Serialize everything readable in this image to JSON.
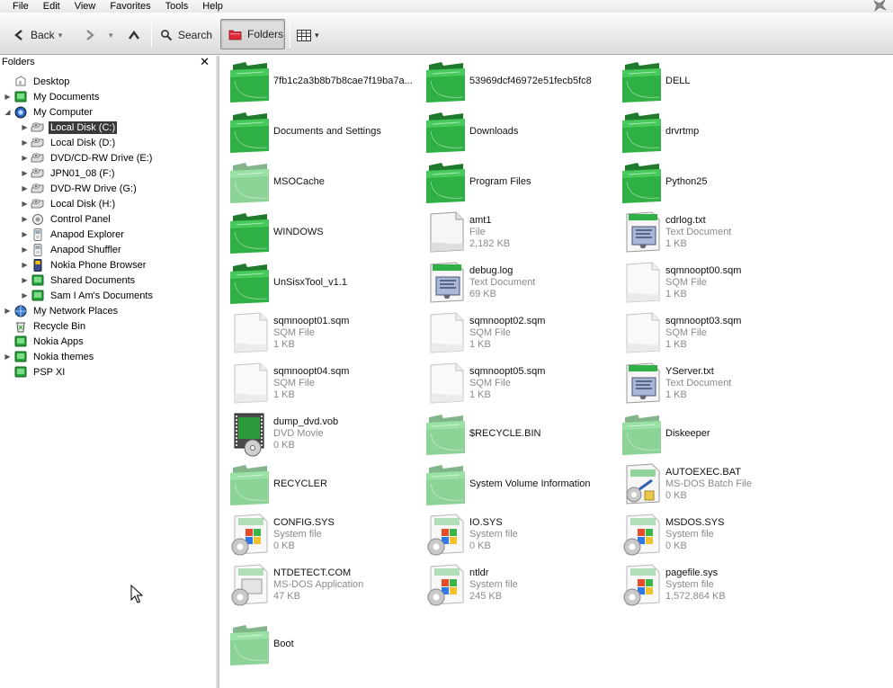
{
  "menu": [
    "File",
    "Edit",
    "View",
    "Favorites",
    "Tools",
    "Help"
  ],
  "toolbar": {
    "back_label": "Back",
    "search_label": "Search",
    "folders_label": "Folders"
  },
  "folders_pane": {
    "title": "Folders",
    "close_glyph": "✕"
  },
  "tree": [
    {
      "label": "Desktop",
      "indent": 0,
      "expander": "",
      "icon": "desktop-icon"
    },
    {
      "label": "My Documents",
      "indent": 0,
      "expander": "▶",
      "icon": "green-folder-icon"
    },
    {
      "label": "My Computer",
      "indent": 0,
      "expander": "◢",
      "icon": "computer-icon"
    },
    {
      "label": "Local Disk (C:)",
      "indent": 1,
      "expander": "▶",
      "icon": "drive-icon",
      "selected": true
    },
    {
      "label": "Local Disk (D:)",
      "indent": 1,
      "expander": "▶",
      "icon": "drive-icon"
    },
    {
      "label": "DVD/CD-RW Drive (E:)",
      "indent": 1,
      "expander": "▶",
      "icon": "drive-icon"
    },
    {
      "label": "JPN01_08 (F:)",
      "indent": 1,
      "expander": "▶",
      "icon": "drive-icon"
    },
    {
      "label": "DVD-RW Drive (G:)",
      "indent": 1,
      "expander": "▶",
      "icon": "drive-icon"
    },
    {
      "label": "Local Disk (H:)",
      "indent": 1,
      "expander": "▶",
      "icon": "drive-icon"
    },
    {
      "label": "Control Panel",
      "indent": 1,
      "expander": "▶",
      "icon": "control-panel-icon"
    },
    {
      "label": "Anapod Explorer",
      "indent": 1,
      "expander": "▶",
      "icon": "ipod-icon"
    },
    {
      "label": "Anapod Shuffler",
      "indent": 1,
      "expander": "▶",
      "icon": "ipod-icon"
    },
    {
      "label": "Nokia Phone Browser",
      "indent": 1,
      "expander": "▶",
      "icon": "phone-icon"
    },
    {
      "label": "Shared Documents",
      "indent": 1,
      "expander": "▶",
      "icon": "green-folder-icon"
    },
    {
      "label": "Sam I Am's Documents",
      "indent": 1,
      "expander": "▶",
      "icon": "green-folder-icon"
    },
    {
      "label": "My Network Places",
      "indent": 0,
      "expander": "▶",
      "icon": "network-icon"
    },
    {
      "label": "Recycle Bin",
      "indent": 0,
      "expander": "",
      "icon": "recycle-bin-icon"
    },
    {
      "label": "Nokia Apps",
      "indent": 0,
      "expander": "",
      "icon": "green-folder-icon"
    },
    {
      "label": "Nokia themes",
      "indent": 0,
      "expander": "▶",
      "icon": "green-folder-icon"
    },
    {
      "label": "PSP XI",
      "indent": 0,
      "expander": "",
      "icon": "green-folder-icon"
    }
  ],
  "files": [
    {
      "name": "7fb1c2a3b8b7b8cae7f19ba7a...",
      "type": "",
      "size": "",
      "icon": "folder"
    },
    {
      "name": "53969dcf46972e51fecb5fc8",
      "type": "",
      "size": "",
      "icon": "folder"
    },
    {
      "name": "DELL",
      "type": "",
      "size": "",
      "icon": "folder"
    },
    {
      "name": "Documents and Settings",
      "type": "",
      "size": "",
      "icon": "folder"
    },
    {
      "name": "Downloads",
      "type": "",
      "size": "",
      "icon": "folder"
    },
    {
      "name": "drvrtmp",
      "type": "",
      "size": "",
      "icon": "folder"
    },
    {
      "name": "MSOCache",
      "type": "",
      "size": "",
      "icon": "folder-hidden"
    },
    {
      "name": "Program Files",
      "type": "",
      "size": "",
      "icon": "folder"
    },
    {
      "name": "Python25",
      "type": "",
      "size": "",
      "icon": "folder"
    },
    {
      "name": "WINDOWS",
      "type": "",
      "size": "",
      "icon": "folder"
    },
    {
      "name": "amt1",
      "type": "File",
      "size": "2,182 KB",
      "icon": "file"
    },
    {
      "name": "cdrlog.txt",
      "type": "Text Document",
      "size": "1 KB",
      "icon": "text"
    },
    {
      "name": "UnSisxTool_v1.1",
      "type": "",
      "size": "",
      "icon": "folder"
    },
    {
      "name": "debug.log",
      "type": "Text Document",
      "size": "69 KB",
      "icon": "text"
    },
    {
      "name": "sqmnoopt00.sqm",
      "type": "SQM File",
      "size": "1 KB",
      "icon": "file-hidden"
    },
    {
      "name": "sqmnoopt01.sqm",
      "type": "SQM File",
      "size": "1 KB",
      "icon": "file-hidden"
    },
    {
      "name": "sqmnoopt02.sqm",
      "type": "SQM File",
      "size": "1 KB",
      "icon": "file-hidden"
    },
    {
      "name": "sqmnoopt03.sqm",
      "type": "SQM File",
      "size": "1 KB",
      "icon": "file-hidden"
    },
    {
      "name": "sqmnoopt04.sqm",
      "type": "SQM File",
      "size": "1 KB",
      "icon": "file-hidden"
    },
    {
      "name": "sqmnoopt05.sqm",
      "type": "SQM File",
      "size": "1 KB",
      "icon": "file-hidden"
    },
    {
      "name": "YServer.txt",
      "type": "Text Document",
      "size": "1 KB",
      "icon": "text"
    },
    {
      "name": "dump_dvd.vob",
      "type": "DVD Movie",
      "size": "0 KB",
      "icon": "video"
    },
    {
      "name": "$RECYCLE.BIN",
      "type": "",
      "size": "",
      "icon": "folder-hidden"
    },
    {
      "name": "Diskeeper",
      "type": "",
      "size": "",
      "icon": "folder-hidden"
    },
    {
      "name": "RECYCLER",
      "type": "",
      "size": "",
      "icon": "folder-hidden"
    },
    {
      "name": "System Volume Information",
      "type": "",
      "size": "",
      "icon": "folder-hidden"
    },
    {
      "name": "AUTOEXEC.BAT",
      "type": "MS-DOS Batch File",
      "size": "0 KB",
      "icon": "batch"
    },
    {
      "name": "CONFIG.SYS",
      "type": "System file",
      "size": "0 KB",
      "icon": "system"
    },
    {
      "name": "IO.SYS",
      "type": "System file",
      "size": "0 KB",
      "icon": "system"
    },
    {
      "name": "MSDOS.SYS",
      "type": "System file",
      "size": "0 KB",
      "icon": "system"
    },
    {
      "name": "NTDETECT.COM",
      "type": "MS-DOS Application",
      "size": "47 KB",
      "icon": "app"
    },
    {
      "name": "ntldr",
      "type": "System file",
      "size": "245 KB",
      "icon": "system"
    },
    {
      "name": "pagefile.sys",
      "type": "System file",
      "size": "1,572,864 KB",
      "icon": "system"
    },
    {
      "name": "Boot",
      "type": "",
      "size": "",
      "icon": "folder-hidden"
    }
  ]
}
